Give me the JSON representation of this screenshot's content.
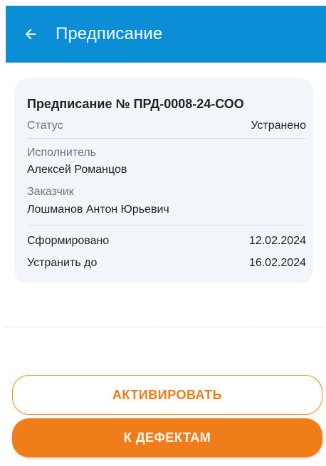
{
  "colors": {
    "app_bar": "#0b8ed6",
    "card_background": "#f2f5fa",
    "accent": "#f07d1a",
    "accent_outline": "#f08a1f",
    "text_primary": "#1f2328",
    "text_secondary": "#6f7682"
  },
  "header": {
    "back_icon": "arrow-left-icon",
    "title": "Предписание"
  },
  "card": {
    "title": "Предписание № ПРД-0008-24-СОО",
    "status_label": "Статус",
    "status_value": "Устранено",
    "performer_label": "Исполнитель",
    "performer_value": "Алексей Романцов",
    "customer_label": "Заказчик",
    "customer_value": "Лошманов Антон Юрьевич",
    "generated_label": "Сформировано",
    "generated_value": "12.02.2024",
    "deadline_label": "Устранить до",
    "deadline_value": "16.02.2024"
  },
  "actions": {
    "activate_label": "АКТИВИРОВАТЬ",
    "defects_label": "К ДЕФЕКТАМ"
  }
}
